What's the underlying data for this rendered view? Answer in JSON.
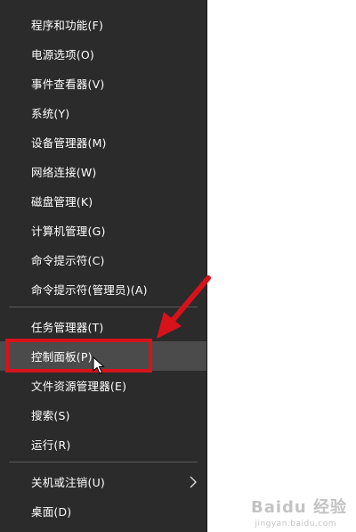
{
  "menu": {
    "items": [
      {
        "label": "程序和功能(F)"
      },
      {
        "label": "电源选项(O)"
      },
      {
        "label": "事件查看器(V)"
      },
      {
        "label": "系统(Y)"
      },
      {
        "label": "设备管理器(M)"
      },
      {
        "label": "网络连接(W)"
      },
      {
        "label": "磁盘管理(K)"
      },
      {
        "label": "计算机管理(G)"
      },
      {
        "label": "命令提示符(C)"
      },
      {
        "label": "命令提示符(管理员)(A)"
      },
      {
        "label": "任务管理器(T)"
      },
      {
        "label": "控制面板(P)"
      },
      {
        "label": "文件资源管理器(E)"
      },
      {
        "label": "搜索(S)"
      },
      {
        "label": "运行(R)"
      },
      {
        "label": "关机或注销(U)"
      },
      {
        "label": "桌面(D)"
      }
    ]
  },
  "annotation": {
    "highlight_color": "#d7121a"
  },
  "watermark": {
    "text": "Baidu 经验",
    "sub": "jingyan.baidu.com"
  },
  "colors": {
    "menu_bg": "#2b2b2b",
    "hover_bg": "#4b4b4b",
    "text": "#ffffff",
    "separator": "#5a5a5a"
  }
}
